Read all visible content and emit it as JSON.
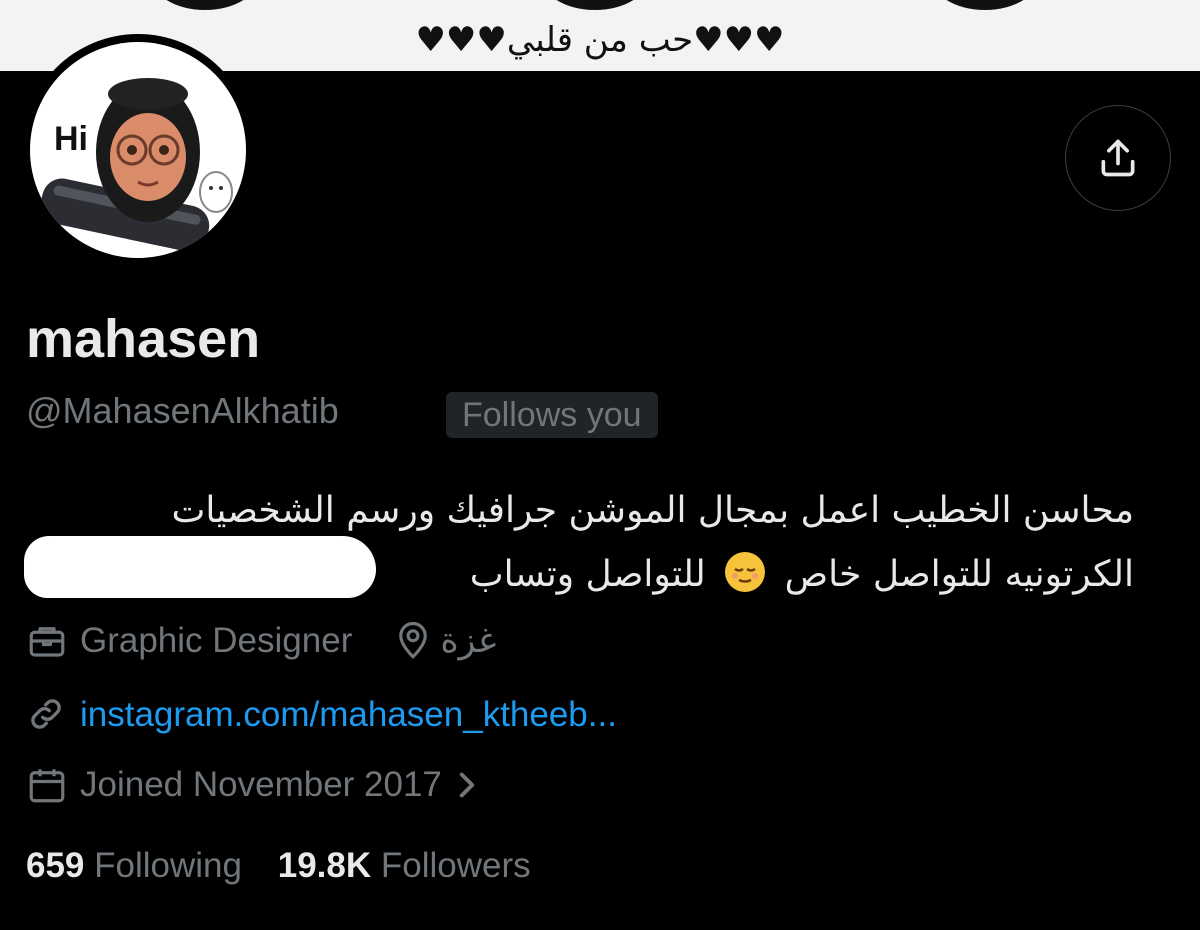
{
  "banner": {
    "text": "♥♥♥حب من قلبي♥♥♥"
  },
  "avatar": {
    "text": "Hi"
  },
  "profile": {
    "name": "mahasen",
    "handle": "@MahasenAlkhatib",
    "follows_you": "Follows you",
    "bio_line1": "محاسن الخطيب اعمل بمجال الموشن جرافيك ورسم الشخصيات",
    "bio_line2_a": "الكرتونيه للتواصل خاص",
    "bio_line2_b": "للتواصل وتساب",
    "profession": "Graphic Designer",
    "location": "غزة",
    "website": "instagram.com/mahasen_ktheeb...",
    "joined": "Joined November 2017"
  },
  "stats": {
    "following_count": "659",
    "following_label": "Following",
    "followers_count": "19.8K",
    "followers_label": "Followers"
  },
  "icons": {
    "share": "share-upload-icon",
    "profession": "briefcase-icon",
    "location": "location-pin-icon",
    "website": "link-icon",
    "joined": "calendar-icon",
    "chevron": "chevron-right-icon",
    "emoji": "relieved-face-emoji"
  },
  "colors": {
    "background": "#000000",
    "text_primary": "#e7e9ea",
    "text_secondary": "#71767b",
    "link": "#1d9bf0",
    "badge_bg": "#202327"
  }
}
